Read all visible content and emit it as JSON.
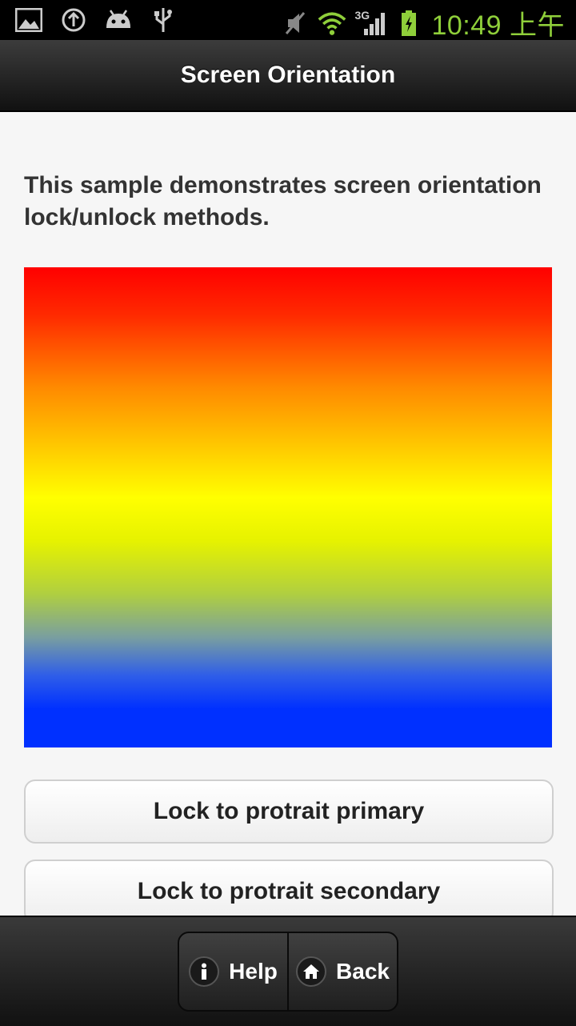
{
  "status_bar": {
    "time": "10:49 上午",
    "network_label": "3G",
    "left_icons": [
      "gallery-icon",
      "sync-icon",
      "android-debug-icon",
      "usb-icon"
    ],
    "right_icons": [
      "mute-icon",
      "wifi-icon",
      "signal-icon",
      "battery-charging-icon"
    ]
  },
  "header": {
    "title": "Screen Orientation"
  },
  "content": {
    "description": "This sample demonstrates screen orientation lock/unlock methods.",
    "gradient_colors": [
      "#ff0000",
      "#ffff00",
      "#0030ff"
    ],
    "buttons": [
      {
        "label": "Lock to protrait primary"
      },
      {
        "label": "Lock to protrait secondary"
      }
    ]
  },
  "footer": {
    "help_label": "Help",
    "back_label": "Back"
  }
}
